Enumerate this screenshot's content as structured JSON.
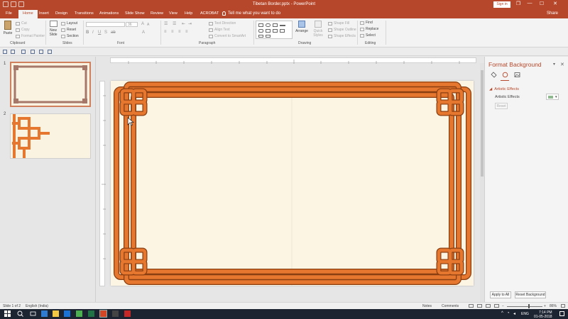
{
  "window": {
    "title": "Tibetan Border.pptx - PowerPoint",
    "sign_in": "Sign in",
    "share": "Share",
    "controls": {
      "restore": "❐",
      "minimize": "—",
      "maximize": "☐",
      "close": "✕"
    }
  },
  "tabs": [
    "File",
    "Home",
    "Insert",
    "Design",
    "Transitions",
    "Animations",
    "Slide Show",
    "Review",
    "View",
    "Help",
    "ACROBAT"
  ],
  "active_tab": "Home",
  "tell_me": "Tell me what you want to do",
  "ribbon": {
    "clipboard": {
      "label": "Clipboard",
      "paste": "Paste",
      "cut": "Cut",
      "copy": "Copy",
      "format_painter": "Format Painter"
    },
    "slides": {
      "label": "Slides",
      "new_slide": "New Slide",
      "layout": "Layout",
      "reset": "Reset",
      "section": "Section"
    },
    "font": {
      "label": "Font",
      "font_size": "36"
    },
    "paragraph": {
      "label": "Paragraph",
      "text_direction": "Text Direction",
      "align_text": "Align Text",
      "convert_smartart": "Convert to SmartArt"
    },
    "drawing": {
      "label": "Drawing",
      "arrange": "Arrange",
      "quick_styles": "Quick Styles",
      "shape_fill": "Shape Fill",
      "shape_outline": "Shape Outline",
      "shape_effects": "Shape Effects"
    },
    "editing": {
      "label": "Editing",
      "find": "Find",
      "replace": "Replace",
      "select": "Select"
    }
  },
  "slides_pane": {
    "numbers": [
      "1",
      "2"
    ]
  },
  "format_background": {
    "title": "Format Background",
    "section": "Artistic Effects",
    "artistic_effects_label": "Artistic Effects",
    "reset": "Reset",
    "apply_to_all": "Apply to All",
    "reset_background": "Reset Background"
  },
  "statusbar": {
    "slide_info": "Slide 1 of 2",
    "language": "English (India)",
    "notes": "Notes",
    "comments": "Comments",
    "zoom": "86%"
  },
  "taskbar": {
    "language": "ENG",
    "time": "7:14 PM",
    "date": "01-05-2018"
  },
  "colors": {
    "accent": "#b7472a",
    "border_orange": "#e6772e",
    "border_outline": "#8a3f12",
    "slide_bg": "#fcf5e3",
    "thumb1_border": "#a6786a"
  }
}
